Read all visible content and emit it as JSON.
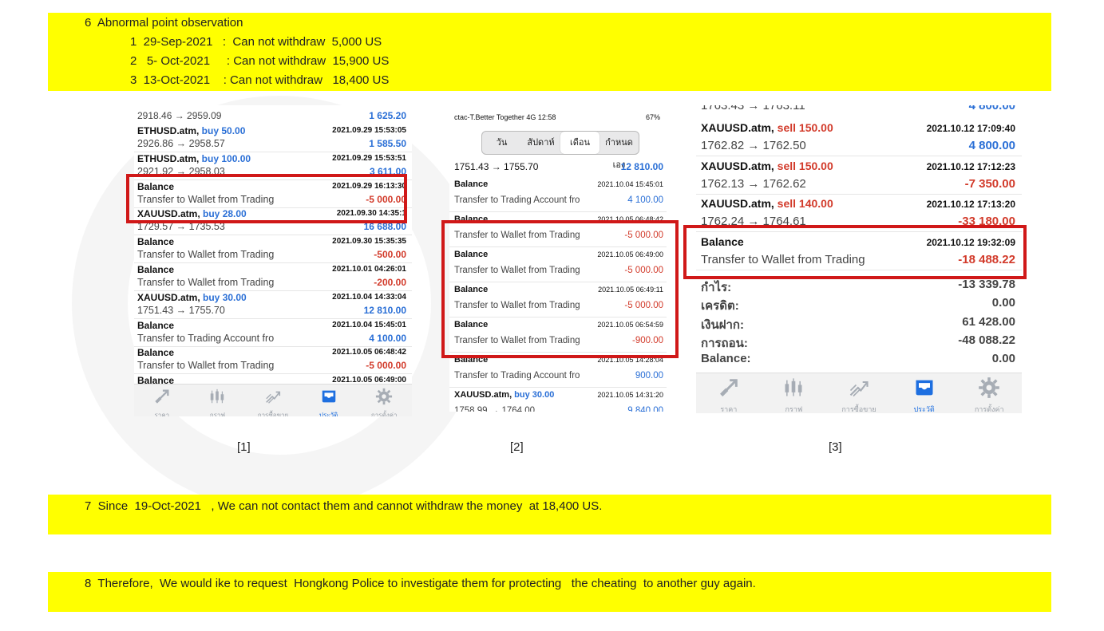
{
  "section6": {
    "heading": "6  Abnormal point observation",
    "items": [
      "1  29-Sep-2021   :  Can not withdraw  5,000 US",
      "2   5- Oct-2021     : Can not withdraw  15,900 US",
      "3  13-Oct-2021    : Can not withdraw   18,400 US"
    ]
  },
  "shot1": {
    "rows": [
      {
        "a": "2918.46 → 2959.09",
        "b": "",
        "c": "",
        "d": "1 625.20",
        "dclass": "blue"
      },
      {
        "a": "ETHUSD.atm,",
        "a2": " buy 50.00",
        "a2class": "blue",
        "b": "2021.09.29 15:53:05",
        "c": "2926.86 → 2958.57",
        "d": "1 585.50",
        "dclass": "blue"
      },
      {
        "a": "ETHUSD.atm,",
        "a2": " buy 100.00",
        "a2class": "blue",
        "b": "2021.09.29 15:53:51",
        "c": "2921.92 → 2958.03",
        "d": "3 611.00",
        "dclass": "blue"
      },
      {
        "a": "Balance",
        "a2": "",
        "b": "2021.09.29 16:13:30",
        "c": "Transfer to Wallet from Trading",
        "d": "-5 000.00",
        "dclass": "red"
      },
      {
        "a": "XAUUSD.atm,",
        "a2": " buy 28.00",
        "a2class": "blue",
        "b": "2021.09.30 14:35:1",
        "c": "1729.57 → 1735.53",
        "d": "16 688.00",
        "dclass": "blue"
      },
      {
        "a": "Balance",
        "a2": "",
        "b": "2021.09.30 15:35:35",
        "c": "Transfer to Wallet from Trading",
        "d": "-500.00",
        "dclass": "red"
      },
      {
        "a": "Balance",
        "a2": "",
        "b": "2021.10.01 04:26:01",
        "c": "Transfer to Wallet from Trading",
        "d": "-200.00",
        "dclass": "red"
      },
      {
        "a": "XAUUSD.atm,",
        "a2": " buy 30.00",
        "a2class": "blue",
        "b": "2021.10.04 14:33:04",
        "c": "1751.43 → 1755.70",
        "d": "12 810.00",
        "dclass": "blue"
      },
      {
        "a": "Balance",
        "a2": "",
        "b": "2021.10.04 15:45:01",
        "c": "Transfer to Trading Account fro",
        "d": "4 100.00",
        "dclass": "blue"
      },
      {
        "a": "Balance",
        "a2": "",
        "b": "2021.10.05 06:48:42",
        "c": "Transfer to Wallet from Trading",
        "d": "-5 000.00",
        "dclass": "red"
      },
      {
        "a": "Balance",
        "a2": "",
        "b": "2021.10.05 06:49:00",
        "c": "",
        "d": "",
        "dclass": ""
      }
    ],
    "tabs": [
      "ราคา",
      "กราฟ",
      "การซื้อขาย",
      "ประวัติ",
      "การตั้งค่า"
    ]
  },
  "shot2": {
    "status_left": "ctac-T.Better Together  4G  12:58",
    "status_right": "67%",
    "segments": [
      "วัน",
      "สัปดาห์",
      "เดือน",
      "กำหนดเอง"
    ],
    "first_line": "1751.43 → 1755.70",
    "first_value": "12 810.00",
    "rows": [
      {
        "a": "Balance",
        "a2": "",
        "b": "2021.10.04 15:45:01",
        "c": "Transfer to Trading Account fro",
        "d": "4 100.00",
        "dclass": "blue"
      },
      {
        "a": "Balance",
        "a2": "",
        "b": "2021.10.05 06:48:42",
        "c": "Transfer to Wallet from Trading",
        "d": "-5 000.00",
        "dclass": "red"
      },
      {
        "a": "Balance",
        "a2": "",
        "b": "2021.10.05 06:49:00",
        "c": "Transfer to Wallet from Trading",
        "d": "-5 000.00",
        "dclass": "red"
      },
      {
        "a": "Balance",
        "a2": "",
        "b": "2021.10.05 06:49:11",
        "c": "Transfer to Wallet from Trading",
        "d": "-5 000.00",
        "dclass": "red"
      },
      {
        "a": "Balance",
        "a2": "",
        "b": "2021.10.05 06:54:59",
        "c": "Transfer to Wallet from Trading",
        "d": "-900.00",
        "dclass": "red"
      },
      {
        "a": "Balance",
        "a2": "",
        "b": "2021.10.05 14:28:04",
        "c": "Transfer to Trading Account fro",
        "d": "900.00",
        "dclass": "blue"
      },
      {
        "a": "XAUUSD.atm,",
        "a2": " buy 30.00",
        "a2class": "blue",
        "b": "2021.10.05 14:31:20",
        "c": "1758.99 → 1764.00",
        "d": "9 840.00",
        "dclass": "blue"
      }
    ]
  },
  "shot3": {
    "top_line": "1763.43 → 1763.11",
    "top_value": "4 800.00",
    "rows": [
      {
        "a": "XAUUSD.atm,",
        "a2": " sell 150.00",
        "a2class": "red",
        "b": "2021.10.12 17:09:40",
        "c": "1762.82 → 1762.50",
        "d": "4 800.00",
        "dclass": "blue"
      },
      {
        "a": "XAUUSD.atm,",
        "a2": " sell 150.00",
        "a2class": "red",
        "b": "2021.10.12 17:12:23",
        "c": "1762.13 → 1762.62",
        "d": "-7 350.00",
        "dclass": "red"
      },
      {
        "a": "XAUUSD.atm,",
        "a2": " sell 140.00",
        "a2class": "red",
        "b": "2021.10.12 17:13:20",
        "c": "1762.24 → 1764.61",
        "d": "-33 180.00",
        "dclass": "red"
      },
      {
        "a": "Balance",
        "a2": "",
        "b": "2021.10.12 19:32:09",
        "c": "Transfer to Wallet from Trading",
        "d": "-18 488.22",
        "dclass": "red"
      }
    ],
    "summary": [
      {
        "label": "กำไร:",
        "value": "-13 339.78"
      },
      {
        "label": "เครดิต:",
        "value": "0.00"
      },
      {
        "label": "เงินฝาก:",
        "value": "61 428.00"
      },
      {
        "label": "การถอน:",
        "value": "-48 088.22"
      },
      {
        "label": "Balance:",
        "value": "0.00"
      }
    ],
    "tabs": [
      "ราคา",
      "กราฟ",
      "การซื้อขาย",
      "ประวัติ",
      "การตั้งค่า"
    ]
  },
  "captions": [
    "[1]",
    "[2]",
    "[3]"
  ],
  "section7": "7  Since  19-Oct-2021   , We can not contact them and cannot withdraw the money  at 18,400 US.",
  "section8": "8  Therefore,  We would ike to request  Hongkong Police to investigate them for protecting   the cheating  to another guy again.",
  "colors": {
    "highlight": "#ffff00",
    "box": "#d01818",
    "blue": "#2a6fd6",
    "red": "#d23a2a"
  }
}
